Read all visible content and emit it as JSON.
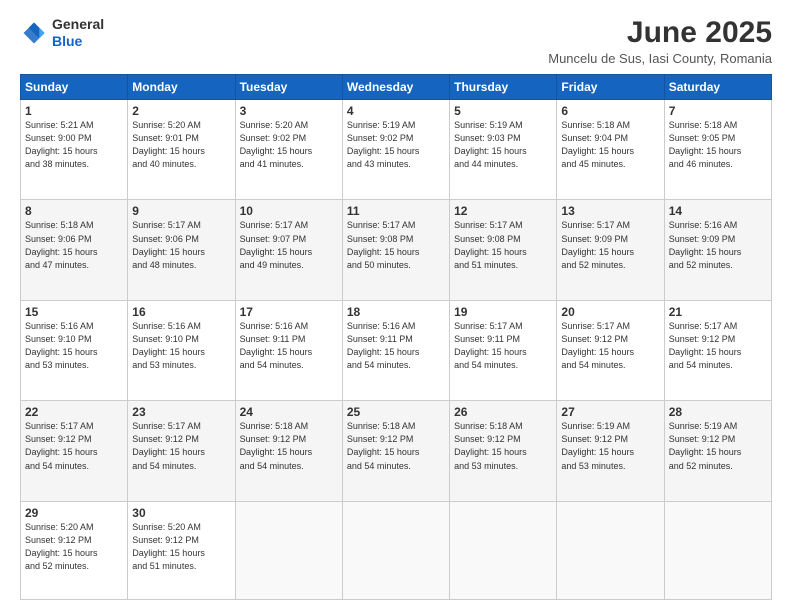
{
  "header": {
    "logo_line1": "General",
    "logo_line2": "Blue",
    "month_title": "June 2025",
    "location": "Muncelu de Sus, Iasi County, Romania"
  },
  "weekdays": [
    "Sunday",
    "Monday",
    "Tuesday",
    "Wednesday",
    "Thursday",
    "Friday",
    "Saturday"
  ],
  "weeks": [
    [
      {
        "day": "1",
        "info": "Sunrise: 5:21 AM\nSunset: 9:00 PM\nDaylight: 15 hours\nand 38 minutes."
      },
      {
        "day": "2",
        "info": "Sunrise: 5:20 AM\nSunset: 9:01 PM\nDaylight: 15 hours\nand 40 minutes."
      },
      {
        "day": "3",
        "info": "Sunrise: 5:20 AM\nSunset: 9:02 PM\nDaylight: 15 hours\nand 41 minutes."
      },
      {
        "day": "4",
        "info": "Sunrise: 5:19 AM\nSunset: 9:02 PM\nDaylight: 15 hours\nand 43 minutes."
      },
      {
        "day": "5",
        "info": "Sunrise: 5:19 AM\nSunset: 9:03 PM\nDaylight: 15 hours\nand 44 minutes."
      },
      {
        "day": "6",
        "info": "Sunrise: 5:18 AM\nSunset: 9:04 PM\nDaylight: 15 hours\nand 45 minutes."
      },
      {
        "day": "7",
        "info": "Sunrise: 5:18 AM\nSunset: 9:05 PM\nDaylight: 15 hours\nand 46 minutes."
      }
    ],
    [
      {
        "day": "8",
        "info": "Sunrise: 5:18 AM\nSunset: 9:06 PM\nDaylight: 15 hours\nand 47 minutes."
      },
      {
        "day": "9",
        "info": "Sunrise: 5:17 AM\nSunset: 9:06 PM\nDaylight: 15 hours\nand 48 minutes."
      },
      {
        "day": "10",
        "info": "Sunrise: 5:17 AM\nSunset: 9:07 PM\nDaylight: 15 hours\nand 49 minutes."
      },
      {
        "day": "11",
        "info": "Sunrise: 5:17 AM\nSunset: 9:08 PM\nDaylight: 15 hours\nand 50 minutes."
      },
      {
        "day": "12",
        "info": "Sunrise: 5:17 AM\nSunset: 9:08 PM\nDaylight: 15 hours\nand 51 minutes."
      },
      {
        "day": "13",
        "info": "Sunrise: 5:17 AM\nSunset: 9:09 PM\nDaylight: 15 hours\nand 52 minutes."
      },
      {
        "day": "14",
        "info": "Sunrise: 5:16 AM\nSunset: 9:09 PM\nDaylight: 15 hours\nand 52 minutes."
      }
    ],
    [
      {
        "day": "15",
        "info": "Sunrise: 5:16 AM\nSunset: 9:10 PM\nDaylight: 15 hours\nand 53 minutes."
      },
      {
        "day": "16",
        "info": "Sunrise: 5:16 AM\nSunset: 9:10 PM\nDaylight: 15 hours\nand 53 minutes."
      },
      {
        "day": "17",
        "info": "Sunrise: 5:16 AM\nSunset: 9:11 PM\nDaylight: 15 hours\nand 54 minutes."
      },
      {
        "day": "18",
        "info": "Sunrise: 5:16 AM\nSunset: 9:11 PM\nDaylight: 15 hours\nand 54 minutes."
      },
      {
        "day": "19",
        "info": "Sunrise: 5:17 AM\nSunset: 9:11 PM\nDaylight: 15 hours\nand 54 minutes."
      },
      {
        "day": "20",
        "info": "Sunrise: 5:17 AM\nSunset: 9:12 PM\nDaylight: 15 hours\nand 54 minutes."
      },
      {
        "day": "21",
        "info": "Sunrise: 5:17 AM\nSunset: 9:12 PM\nDaylight: 15 hours\nand 54 minutes."
      }
    ],
    [
      {
        "day": "22",
        "info": "Sunrise: 5:17 AM\nSunset: 9:12 PM\nDaylight: 15 hours\nand 54 minutes."
      },
      {
        "day": "23",
        "info": "Sunrise: 5:17 AM\nSunset: 9:12 PM\nDaylight: 15 hours\nand 54 minutes."
      },
      {
        "day": "24",
        "info": "Sunrise: 5:18 AM\nSunset: 9:12 PM\nDaylight: 15 hours\nand 54 minutes."
      },
      {
        "day": "25",
        "info": "Sunrise: 5:18 AM\nSunset: 9:12 PM\nDaylight: 15 hours\nand 54 minutes."
      },
      {
        "day": "26",
        "info": "Sunrise: 5:18 AM\nSunset: 9:12 PM\nDaylight: 15 hours\nand 53 minutes."
      },
      {
        "day": "27",
        "info": "Sunrise: 5:19 AM\nSunset: 9:12 PM\nDaylight: 15 hours\nand 53 minutes."
      },
      {
        "day": "28",
        "info": "Sunrise: 5:19 AM\nSunset: 9:12 PM\nDaylight: 15 hours\nand 52 minutes."
      }
    ],
    [
      {
        "day": "29",
        "info": "Sunrise: 5:20 AM\nSunset: 9:12 PM\nDaylight: 15 hours\nand 52 minutes."
      },
      {
        "day": "30",
        "info": "Sunrise: 5:20 AM\nSunset: 9:12 PM\nDaylight: 15 hours\nand 51 minutes."
      },
      {
        "day": "",
        "info": ""
      },
      {
        "day": "",
        "info": ""
      },
      {
        "day": "",
        "info": ""
      },
      {
        "day": "",
        "info": ""
      },
      {
        "day": "",
        "info": ""
      }
    ]
  ]
}
